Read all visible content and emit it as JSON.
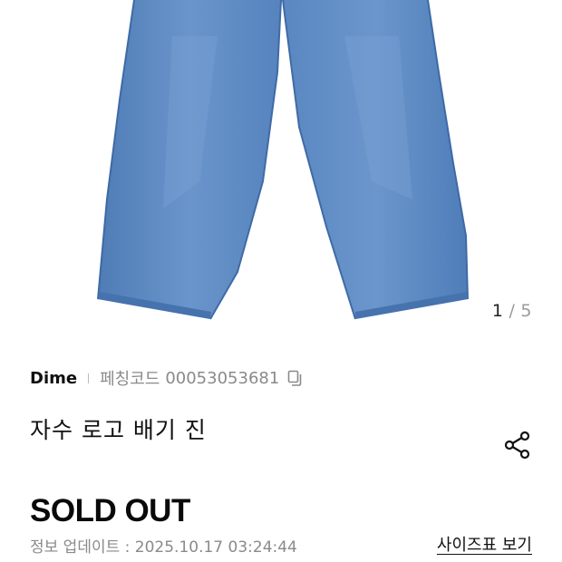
{
  "gallery": {
    "current": "1",
    "separator": "/",
    "total": "5"
  },
  "product": {
    "brand": "Dime",
    "code_label": "페칭코드",
    "code_value": "00053053681",
    "name": "자수 로고 배기 진",
    "status": "SOLD OUT",
    "update_label": "정보 업데이트 : ",
    "update_time": "2025.10.17 03:24:44",
    "size_chart_label": "사이즈표 보기"
  },
  "icons": {
    "copy": "copy-icon",
    "share": "share-icon"
  },
  "colors": {
    "denim": "#5b86bf",
    "text_primary": "#111111",
    "text_secondary": "#8a8a8a"
  }
}
